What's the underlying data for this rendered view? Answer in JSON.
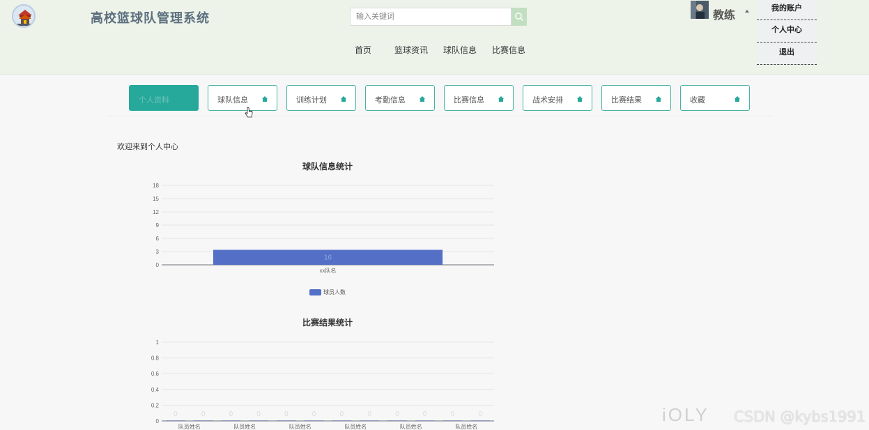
{
  "header": {
    "title": "高校篮球队管理系统",
    "search_placeholder": "输入关键词",
    "nav": [
      "首页",
      "篮球资讯",
      "球队信息",
      "比赛信息"
    ],
    "user_name": "教练",
    "dropdown": [
      "我的账户",
      "个人中心",
      "退出"
    ]
  },
  "tabs": [
    {
      "label": "个人资料",
      "active": true
    },
    {
      "label": "球队信息",
      "active": false
    },
    {
      "label": "训练计划",
      "active": false
    },
    {
      "label": "考勤信息",
      "active": false
    },
    {
      "label": "比赛信息",
      "active": false
    },
    {
      "label": "战术安排",
      "active": false
    },
    {
      "label": "比赛结果",
      "active": false
    },
    {
      "label": "收藏",
      "active": false
    }
  ],
  "welcome": "欢迎来到个人中心",
  "chart_data": [
    {
      "type": "bar",
      "title": "球队信息统计",
      "categories": [
        "xx队名"
      ],
      "series": [
        {
          "name": "球员人数",
          "values": [
            16
          ],
          "color": "#5470c6"
        }
      ],
      "yticks": [
        0,
        3,
        6,
        9,
        12,
        15,
        18
      ],
      "ylim": [
        0,
        18
      ],
      "bar_visual_value": 3.4,
      "grid": true,
      "legend": "bottom"
    },
    {
      "type": "bar",
      "title": "比赛结果统计",
      "categories": [
        "队员姓名",
        "队员姓名",
        "队员姓名",
        "队员姓名",
        "队员姓名",
        "队员姓名",
        "队员姓名",
        "队员姓名",
        "队员姓名",
        "队员姓名",
        "队员姓名",
        "队员姓名"
      ],
      "tick_labels_shown": [
        "队员姓名",
        "",
        "队员姓名",
        "",
        "队员姓名",
        "",
        "队员姓名",
        "",
        "队员姓名",
        "",
        "队员姓名",
        ""
      ],
      "series": [
        {
          "values": [
            0,
            0,
            0,
            0,
            0,
            0,
            0,
            0,
            0,
            0,
            0,
            0
          ],
          "color": "#5470c6"
        }
      ],
      "yticks": [
        0,
        0.2,
        0.4,
        0.6,
        0.8,
        1
      ],
      "ylim": [
        0,
        1
      ],
      "grid": true
    }
  ],
  "watermark": "iOLY",
  "csdn": "CSDN @kybs1991"
}
